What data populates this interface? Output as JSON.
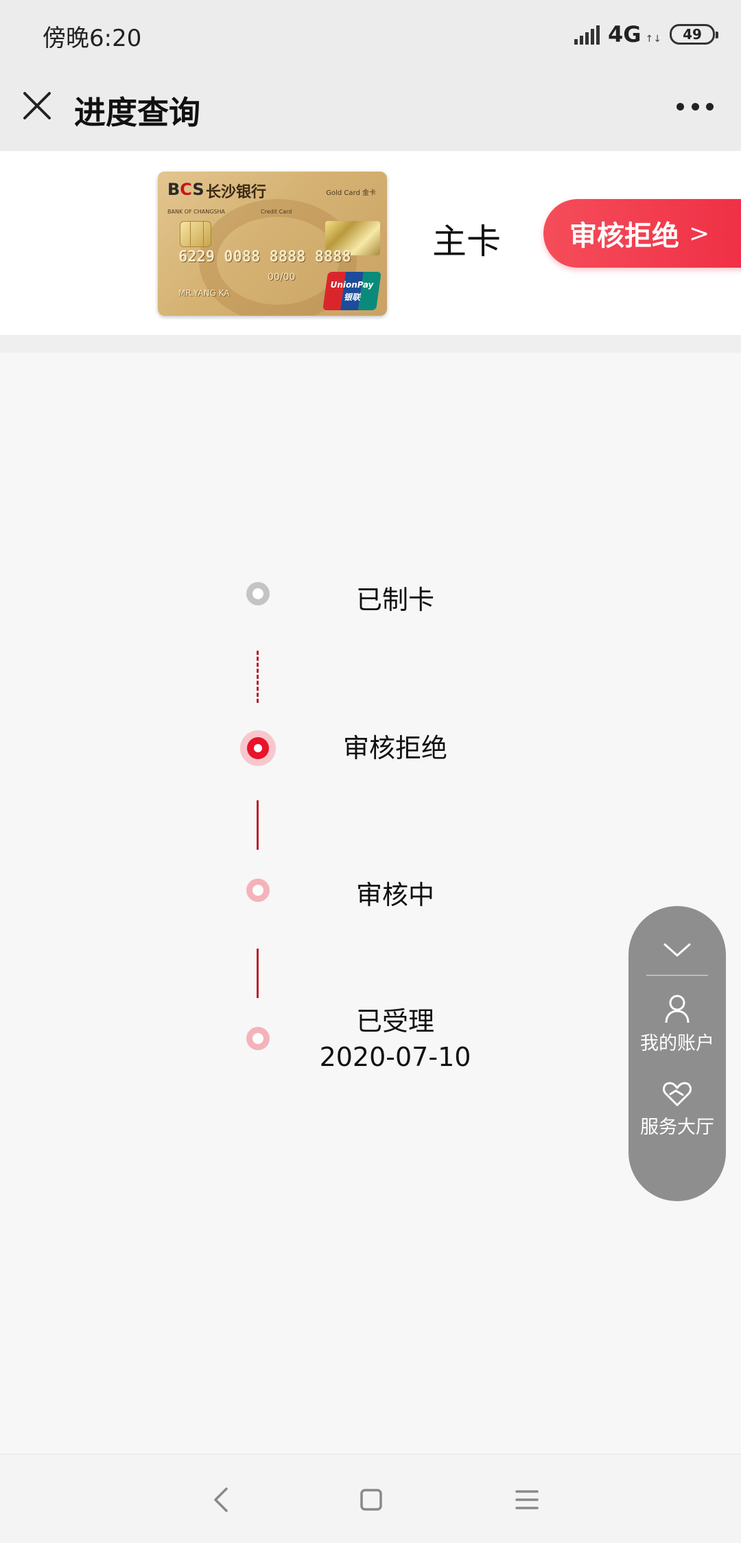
{
  "status_bar": {
    "time": "傍晚6:20",
    "network": "4G",
    "battery": "49"
  },
  "header": {
    "title": "进度查询"
  },
  "card": {
    "logo_b": "B",
    "logo_c": "C",
    "logo_s": "S",
    "bank_name": "长沙银行",
    "gold_label": "Gold Card 金卡",
    "bank_en": "BANK OF CHANGSHA",
    "credit_label": "Credit Card",
    "number": "6229 0088 8888 8888",
    "valid": "00/00",
    "holder": "MR.YANG KA",
    "unionpay_line1": "UnionPay",
    "unionpay_line2": "银联",
    "type_label": "主卡",
    "status_label": "审核拒绝",
    "status_arrow": ">"
  },
  "timeline": {
    "steps": [
      {
        "label": "已制卡",
        "date": "",
        "state": "future"
      },
      {
        "label": "审核拒绝",
        "date": "",
        "state": "current"
      },
      {
        "label": "审核中",
        "date": "",
        "state": "done"
      },
      {
        "label": "已受理",
        "date": "2020-07-10",
        "state": "done"
      }
    ]
  },
  "float_menu": {
    "account_label": "我的账户",
    "service_label": "服务大厅"
  },
  "colors": {
    "accent_red": "#e8142a",
    "line_red": "#b81c2a",
    "pill_red": "#f0334a",
    "future_gray": "#c4c4c4",
    "done_pink": "#f4b3bb"
  },
  "icons": {
    "close": "close-icon",
    "more": "more-icon",
    "collapse": "chevron-down-icon",
    "account": "user-icon",
    "service": "heart-hands-icon",
    "back": "back-icon",
    "home": "home-icon",
    "menu": "menu-icon"
  }
}
